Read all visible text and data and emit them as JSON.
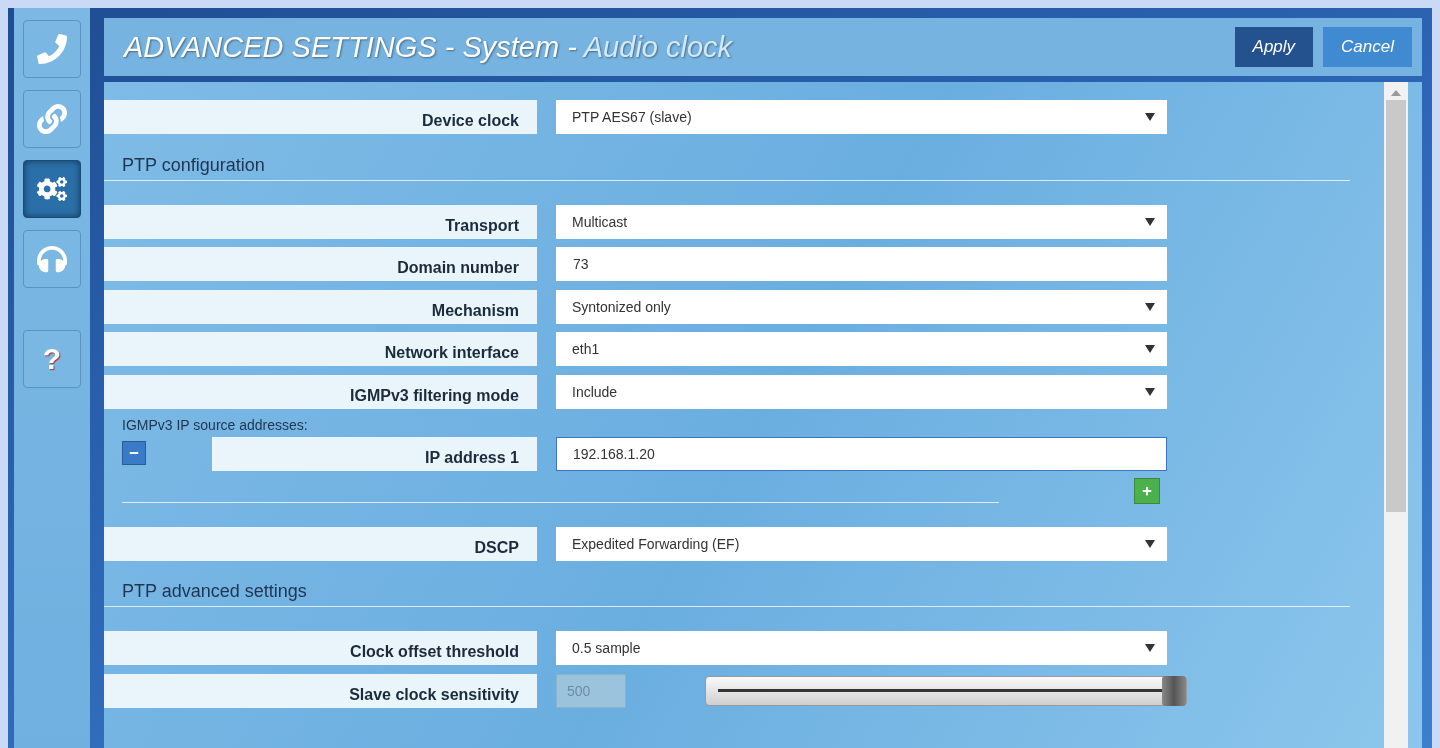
{
  "sidebar": {
    "items": [
      {
        "kind": "phone",
        "selected": false
      },
      {
        "kind": "link",
        "selected": false
      },
      {
        "kind": "settings",
        "selected": true
      },
      {
        "kind": "headphones",
        "selected": false
      },
      {
        "kind": "help",
        "label": "?",
        "selected": false
      }
    ]
  },
  "header": {
    "title": "ADVANCED SETTINGS - System -",
    "subtitle": "Audio clock",
    "buttons": [
      {
        "label": "Apply",
        "kind": "primary"
      },
      {
        "label": "Cancel",
        "kind": "secondary"
      }
    ]
  },
  "sections": [
    {
      "rows": [
        {
          "kind": "select",
          "label": "Device clock",
          "value": "PTP AES67 (slave)"
        }
      ]
    },
    {
      "heading": "PTP configuration",
      "rows": [
        {
          "kind": "select",
          "label": "Transport",
          "value": "Multicast"
        },
        {
          "kind": "input",
          "label": "Domain number",
          "value": "73"
        },
        {
          "kind": "select",
          "label": "Mechanism",
          "value": "Syntonized only"
        },
        {
          "kind": "select",
          "label": "Network interface",
          "value": "eth1"
        },
        {
          "kind": "select",
          "label": "IGMPv3 filtering mode",
          "value": "Include"
        },
        {
          "kind": "address_list",
          "label": "IGMPv3 IP source addresses:",
          "addresses": [
            {
              "label": "IP address 1",
              "value": "192.168.1.20",
              "focused": true
            }
          ]
        },
        {
          "kind": "divider"
        },
        {
          "kind": "select",
          "label": "DSCP",
          "value": "Expedited Forwarding (EF)"
        }
      ]
    },
    {
      "heading": "PTP advanced settings",
      "rows": [
        {
          "kind": "select",
          "label": "Clock offset threshold",
          "value": "0.5 sample"
        },
        {
          "kind": "slider",
          "label": "Slave clock sensitivity",
          "value": "500",
          "level": 1
        }
      ]
    }
  ]
}
